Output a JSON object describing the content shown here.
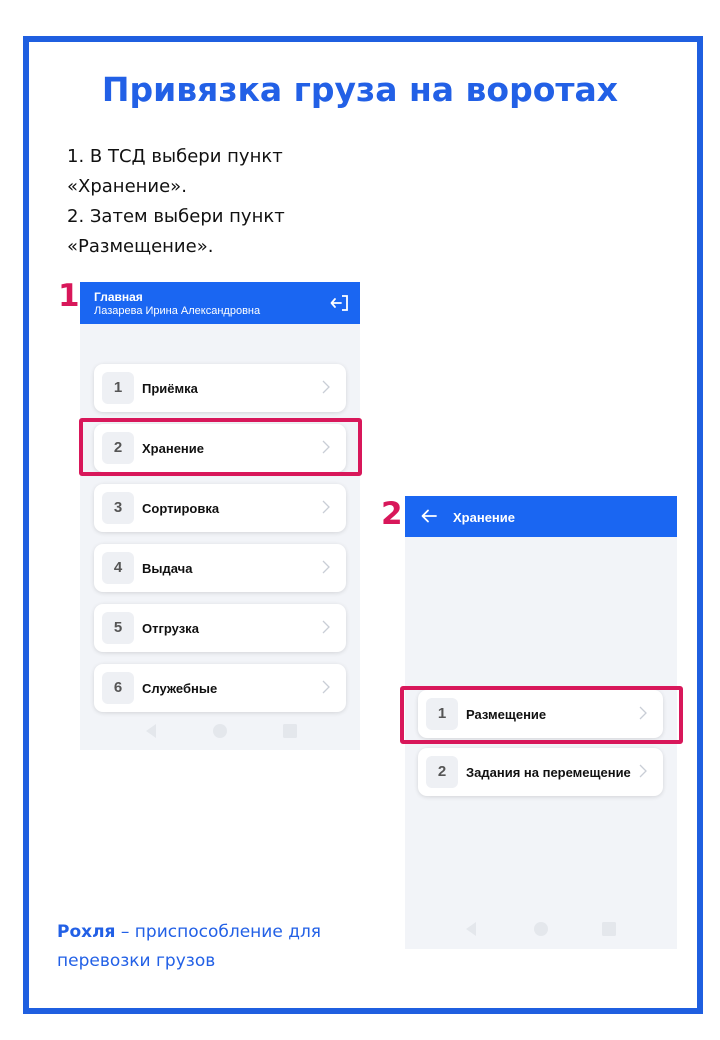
{
  "page": {
    "title": "Привязка груза на воротах",
    "instructions": [
      "1. В ТСД выбери пункт",
      "«Хранение».",
      "2. Затем выбери пункт",
      "«Размещение»."
    ],
    "step1_label": "1",
    "step2_label": "2",
    "footnote": {
      "term": "Рохля",
      "definition": " – приспособление для перевозки грузов"
    }
  },
  "screen_main": {
    "header_title": "Главная",
    "header_user": "Лазарева Ирина Александровна",
    "header_icon": "logout-icon",
    "menu": [
      {
        "num": "1",
        "label": "Приёмка"
      },
      {
        "num": "2",
        "label": "Хранение"
      },
      {
        "num": "3",
        "label": "Сортировка"
      },
      {
        "num": "4",
        "label": "Выдача"
      },
      {
        "num": "5",
        "label": "Отгрузка"
      },
      {
        "num": "6",
        "label": "Служебные"
      }
    ],
    "highlighted": "Хранение"
  },
  "screen_storage": {
    "header_title": "Хранение",
    "header_icon": "back-arrow-icon",
    "menu": [
      {
        "num": "1",
        "label": "Размещение"
      },
      {
        "num": "2",
        "label": "Задания на перемещение"
      }
    ],
    "highlighted": "Размещение"
  },
  "colors": {
    "accent_blue": "#1f5fe0",
    "header_blue": "#1a66f2",
    "highlight_pink": "#d8175a"
  }
}
